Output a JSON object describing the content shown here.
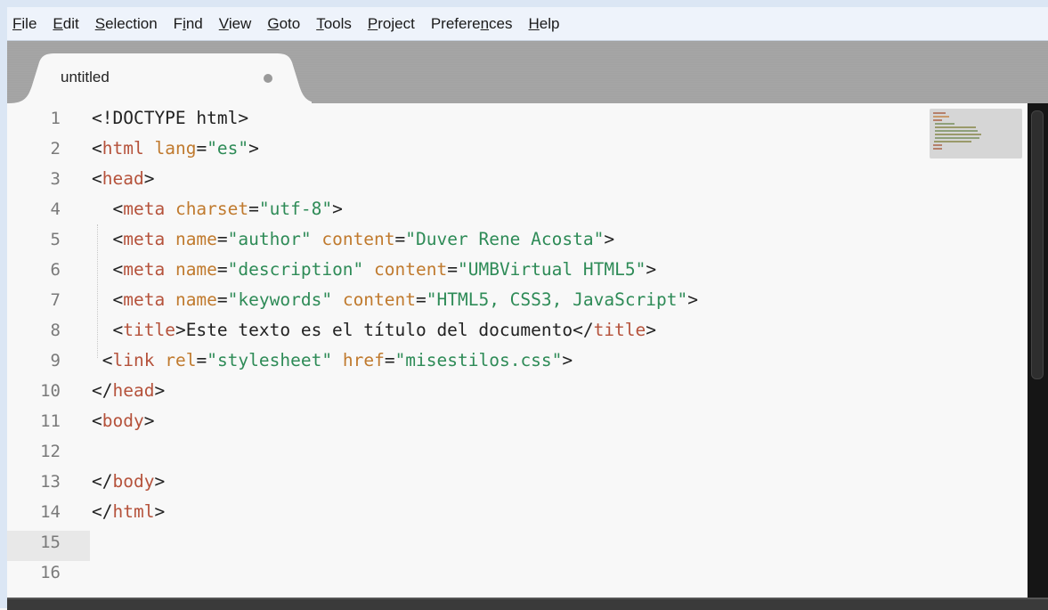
{
  "menu": [
    {
      "key": "F",
      "rest": "ile"
    },
    {
      "key": "E",
      "rest": "dit"
    },
    {
      "key": "S",
      "rest": "election"
    },
    {
      "pre": "F",
      "key": "i",
      "rest": "nd"
    },
    {
      "key": "V",
      "rest": "iew"
    },
    {
      "key": "G",
      "rest": "oto"
    },
    {
      "key": "T",
      "rest": "ools"
    },
    {
      "key": "P",
      "rest": "roject"
    },
    {
      "pre": "Prefere",
      "key": "n",
      "rest": "ces"
    },
    {
      "key": "H",
      "rest": "elp"
    }
  ],
  "tab": {
    "label": "untitled",
    "dirty_indicator": "dot"
  },
  "colors": {
    "tag": "#b5523b",
    "attr": "#c07a2e",
    "string": "#2e8b57",
    "text": "#222222",
    "tabbar": "#a2a2a2",
    "editor_bg": "#f8f8f8",
    "scrollbar": "#151515"
  },
  "lines": [
    {
      "n": "1",
      "tokens": [
        [
          "br",
          "<!DOCTYPE html>"
        ]
      ]
    },
    {
      "n": "2",
      "tokens": [
        [
          "br",
          "<"
        ],
        [
          "tag",
          "html"
        ],
        [
          "txt",
          " "
        ],
        [
          "attr",
          "lang"
        ],
        [
          "eq",
          "="
        ],
        [
          "str",
          "\"es\""
        ],
        [
          "br",
          ">"
        ]
      ]
    },
    {
      "n": "3",
      "tokens": [
        [
          "br",
          "<"
        ],
        [
          "tag",
          "head"
        ],
        [
          "br",
          ">"
        ]
      ]
    },
    {
      "n": "4",
      "tokens": [
        [
          "txt",
          "  "
        ],
        [
          "br",
          "<"
        ],
        [
          "tag",
          "meta"
        ],
        [
          "txt",
          " "
        ],
        [
          "attr",
          "charset"
        ],
        [
          "eq",
          "="
        ],
        [
          "str",
          "\"utf-8\""
        ],
        [
          "br",
          ">"
        ]
      ]
    },
    {
      "n": "5",
      "tokens": [
        [
          "txt",
          "  "
        ],
        [
          "br",
          "<"
        ],
        [
          "tag",
          "meta"
        ],
        [
          "txt",
          " "
        ],
        [
          "attr",
          "name"
        ],
        [
          "eq",
          "="
        ],
        [
          "str",
          "\"author\""
        ],
        [
          "txt",
          " "
        ],
        [
          "attr",
          "content"
        ],
        [
          "eq",
          "="
        ],
        [
          "str",
          "\"Duver Rene Acosta\""
        ],
        [
          "br",
          ">"
        ]
      ]
    },
    {
      "n": "6",
      "tokens": [
        [
          "txt",
          "  "
        ],
        [
          "br",
          "<"
        ],
        [
          "tag",
          "meta"
        ],
        [
          "txt",
          " "
        ],
        [
          "attr",
          "name"
        ],
        [
          "eq",
          "="
        ],
        [
          "str",
          "\"description\""
        ],
        [
          "txt",
          " "
        ],
        [
          "attr",
          "content"
        ],
        [
          "eq",
          "="
        ],
        [
          "str",
          "\"UMBVirtual HTML5\""
        ],
        [
          "br",
          ">"
        ]
      ]
    },
    {
      "n": "7",
      "tokens": [
        [
          "txt",
          "  "
        ],
        [
          "br",
          "<"
        ],
        [
          "tag",
          "meta"
        ],
        [
          "txt",
          " "
        ],
        [
          "attr",
          "name"
        ],
        [
          "eq",
          "="
        ],
        [
          "str",
          "\"keywords\""
        ],
        [
          "txt",
          " "
        ],
        [
          "attr",
          "content"
        ],
        [
          "eq",
          "="
        ],
        [
          "str",
          "\"HTML5, CSS3, JavaScript\""
        ],
        [
          "br",
          ">"
        ]
      ]
    },
    {
      "n": "8",
      "tokens": [
        [
          "txt",
          "  "
        ],
        [
          "br",
          "<"
        ],
        [
          "tag",
          "title"
        ],
        [
          "br",
          ">"
        ],
        [
          "txt",
          "Este texto es el título del documento"
        ],
        [
          "br",
          "</"
        ],
        [
          "tag",
          "title"
        ],
        [
          "br",
          ">"
        ]
      ]
    },
    {
      "n": "9",
      "tokens": [
        [
          "txt",
          " "
        ],
        [
          "br",
          "<"
        ],
        [
          "tag",
          "link"
        ],
        [
          "txt",
          " "
        ],
        [
          "attr",
          "rel"
        ],
        [
          "eq",
          "="
        ],
        [
          "str",
          "\"stylesheet\""
        ],
        [
          "txt",
          " "
        ],
        [
          "attr",
          "href"
        ],
        [
          "eq",
          "="
        ],
        [
          "str",
          "\"misestilos.css\""
        ],
        [
          "br",
          ">"
        ]
      ]
    },
    {
      "n": "10",
      "tokens": [
        [
          "br",
          "</"
        ],
        [
          "tag",
          "head"
        ],
        [
          "br",
          ">"
        ]
      ]
    },
    {
      "n": "11",
      "tokens": [
        [
          "br",
          "<"
        ],
        [
          "tag",
          "body"
        ],
        [
          "br",
          ">"
        ]
      ]
    },
    {
      "n": "12",
      "tokens": []
    },
    {
      "n": "13",
      "tokens": [
        [
          "br",
          "</"
        ],
        [
          "tag",
          "body"
        ],
        [
          "br",
          ">"
        ]
      ]
    },
    {
      "n": "14",
      "tokens": [
        [
          "br",
          "</"
        ],
        [
          "tag",
          "html"
        ],
        [
          "br",
          ">"
        ]
      ]
    },
    {
      "n": "15",
      "tokens": []
    },
    {
      "n": "16",
      "tokens": []
    }
  ],
  "current_line": "15"
}
